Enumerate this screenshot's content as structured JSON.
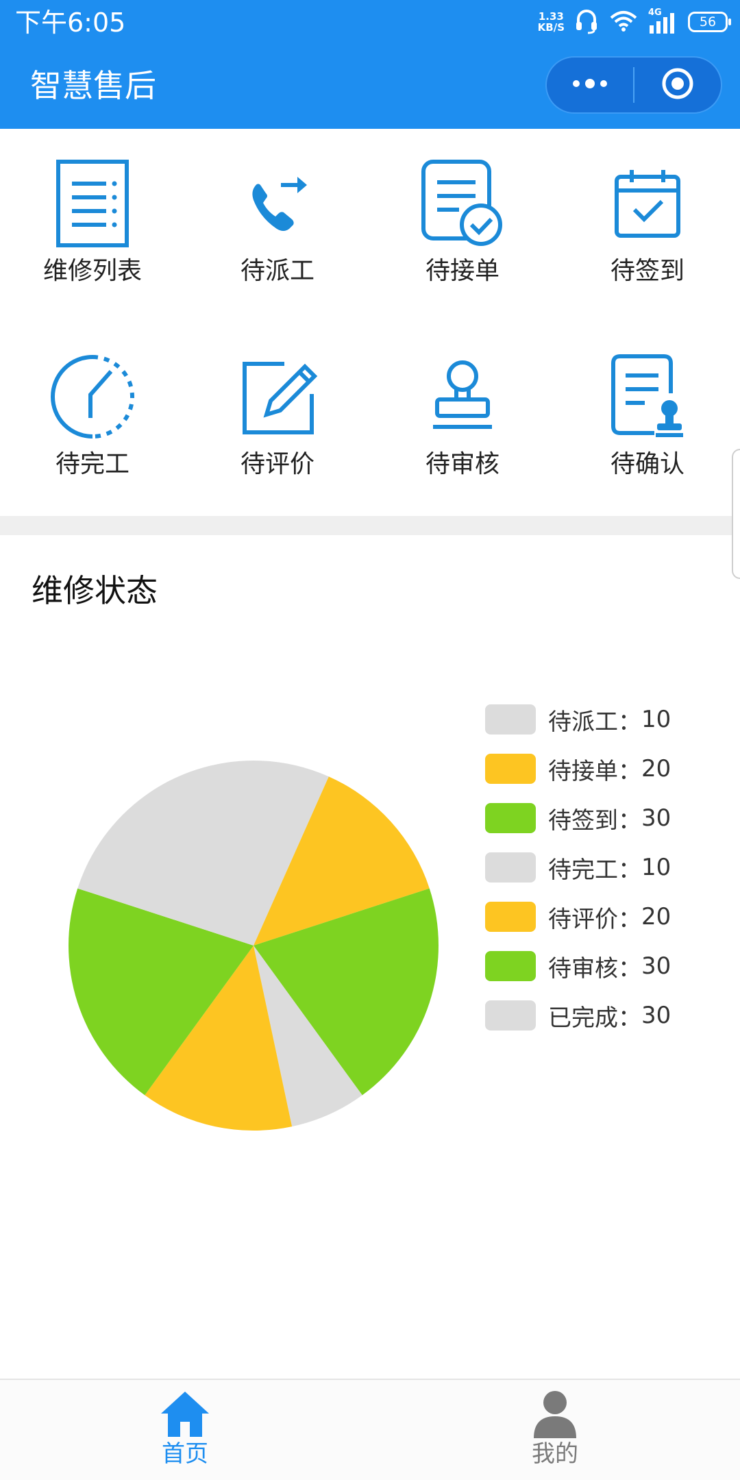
{
  "status_bar": {
    "time": "下午6:05",
    "net_speed_value": "1.33",
    "net_speed_unit": "KB/S",
    "network": "4G",
    "battery": "56"
  },
  "header": {
    "title": "智慧售后",
    "more_icon": "more-dots-icon",
    "close_icon": "target-circle-icon"
  },
  "grid": [
    {
      "label": "维修列表",
      "icon": "list-document-icon"
    },
    {
      "label": "待派工",
      "icon": "phone-forward-icon"
    },
    {
      "label": "待接单",
      "icon": "document-check-icon"
    },
    {
      "label": "待签到",
      "icon": "calendar-check-icon"
    },
    {
      "label": "待完工",
      "icon": "clock-dashed-icon"
    },
    {
      "label": "待评价",
      "icon": "edit-pencil-icon"
    },
    {
      "label": "待审核",
      "icon": "stamp-icon"
    },
    {
      "label": "待确认",
      "icon": "document-seal-icon"
    }
  ],
  "section": {
    "title": "维修状态"
  },
  "colors": {
    "accent": "#1e8ef0",
    "gray": "#dcdcdc",
    "yellow": "#fdc522",
    "green": "#7ed321"
  },
  "chart_data": {
    "type": "pie",
    "categories": [
      "待派工",
      "待接单",
      "待签到",
      "待完工",
      "待评价",
      "待审核",
      "已完成"
    ],
    "values": [
      10,
      20,
      30,
      10,
      20,
      30,
      30
    ],
    "legend_placement": "right",
    "legend": [
      {
        "label": "待派工：",
        "value": "10",
        "color": "#dcdcdc"
      },
      {
        "label": "待接单：",
        "value": "20",
        "color": "#fdc522"
      },
      {
        "label": "待签到：",
        "value": "30",
        "color": "#7ed321"
      },
      {
        "label": "待完工：",
        "value": "10",
        "color": "#dcdcdc"
      },
      {
        "label": "待评价：",
        "value": "20",
        "color": "#fdc522"
      },
      {
        "label": "待审核：",
        "value": "30",
        "color": "#7ed321"
      },
      {
        "label": "已完成：",
        "value": "30",
        "color": "#dcdcdc"
      }
    ]
  },
  "tabbar": [
    {
      "label": "首页",
      "icon": "home-icon",
      "active": true
    },
    {
      "label": "我的",
      "icon": "user-icon",
      "active": false
    }
  ]
}
